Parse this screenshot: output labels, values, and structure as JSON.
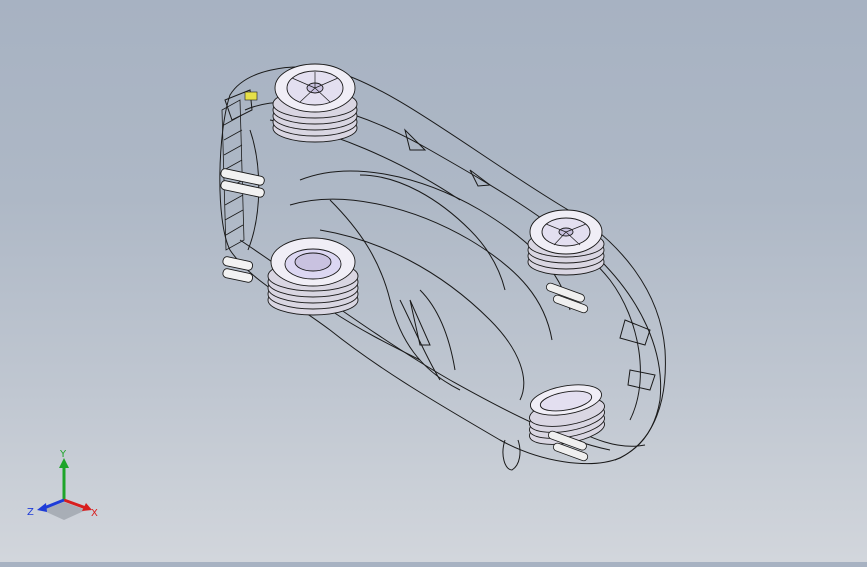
{
  "viewport": {
    "model": "sports-car-wireframe",
    "render_mode": "wireframe",
    "background_top": "#a7b2c2",
    "background_bottom": "#d2d6dc",
    "line_color": "#1a1a1a",
    "wheel_fill": "#e8e4f0"
  },
  "triad": {
    "x_label": "X",
    "y_label": "Y",
    "z_label": "Z",
    "x_color": "#d81e1e",
    "y_color": "#1ea52a",
    "z_color": "#1e3cd8"
  }
}
